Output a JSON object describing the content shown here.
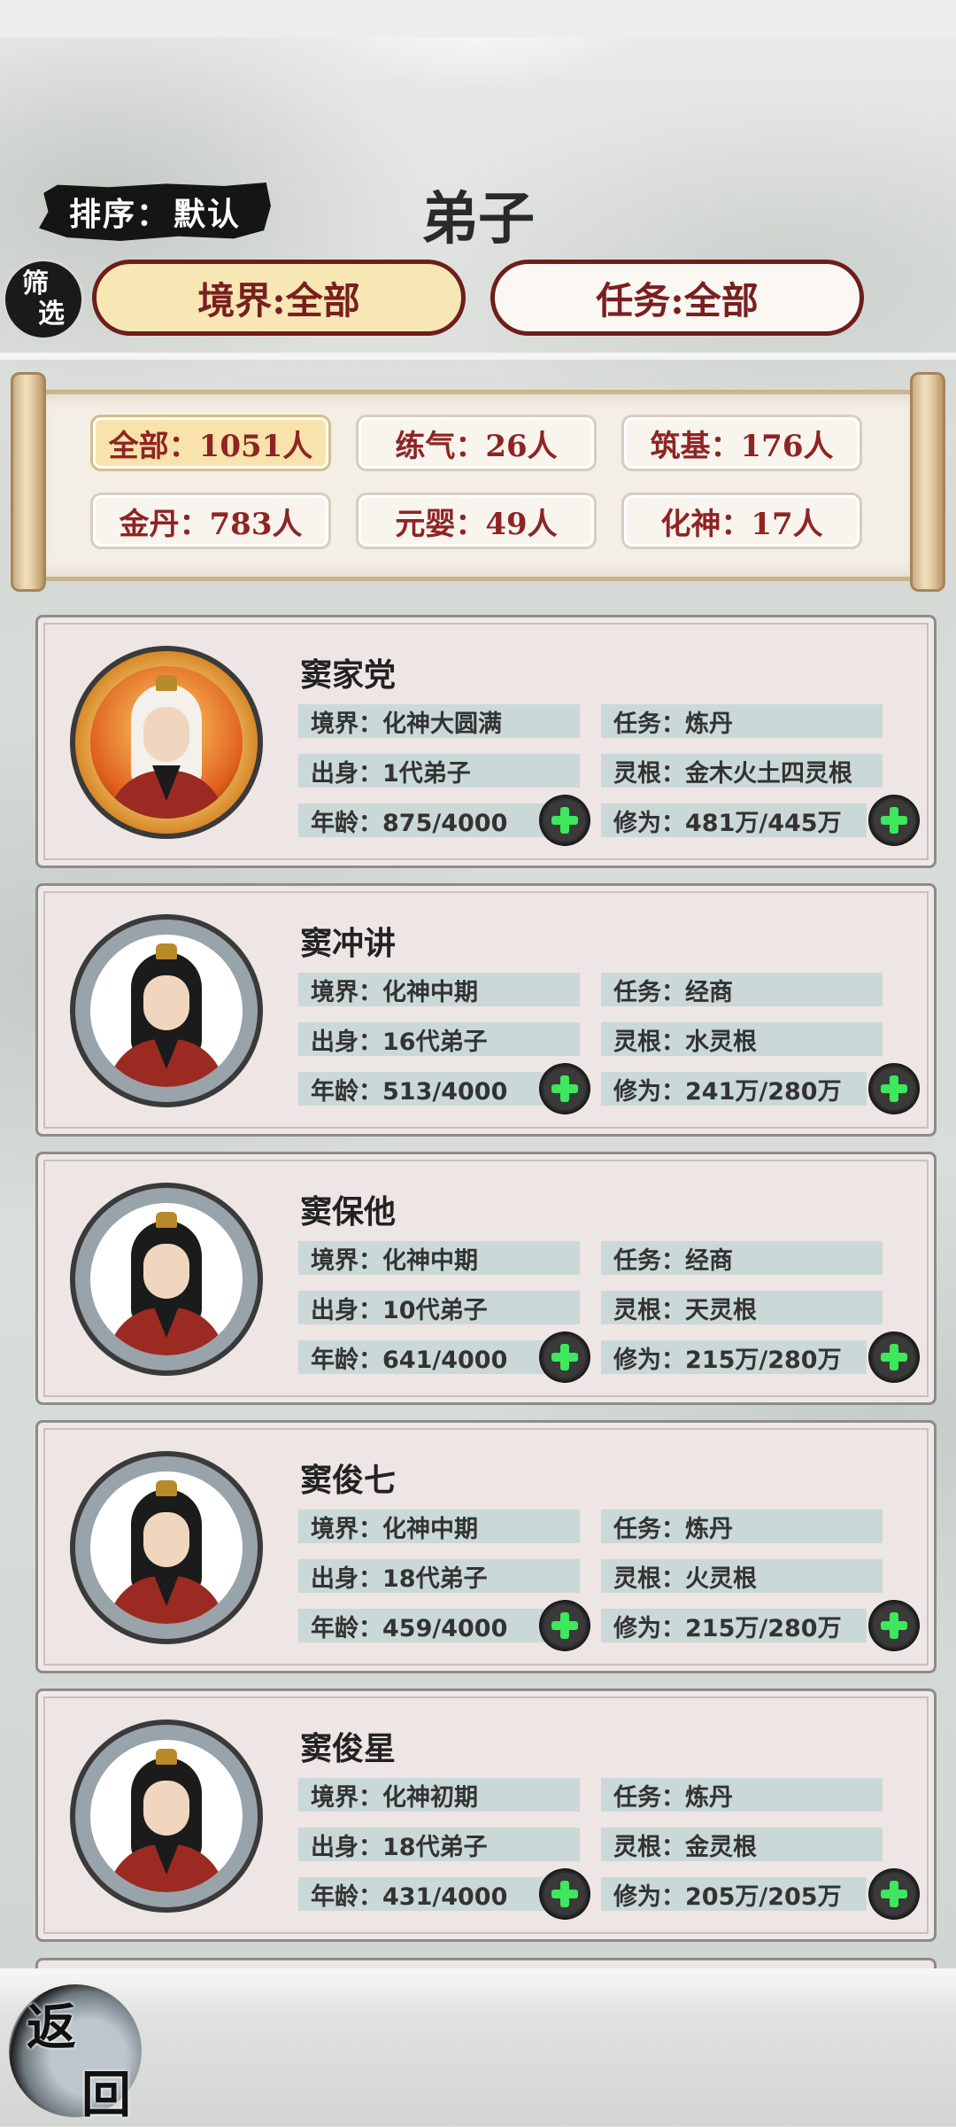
{
  "header": {
    "title": "弟子",
    "sort_label": "排序：",
    "sort_value": "默认",
    "filter_icon_top": "筛",
    "filter_icon_bottom": "选",
    "realm_filter": "境界:全部",
    "task_filter": "任务:全部"
  },
  "stats": [
    {
      "label": "全部：1051人",
      "active": true
    },
    {
      "label": "练气：26人",
      "active": false
    },
    {
      "label": "筑基：176人",
      "active": false
    },
    {
      "label": "金丹：783人",
      "active": false
    },
    {
      "label": "元婴：49人",
      "active": false
    },
    {
      "label": "化神：17人",
      "active": false
    }
  ],
  "disciples": [
    {
      "name": "窦家党",
      "realm": "境界：化神大圆满",
      "task": "任务：炼丹",
      "origin": "出身：1代弟子",
      "root": "灵根：金木火土四灵根",
      "age": "年龄：875/4000",
      "cultivation": "修为：481万/445万",
      "avatar": "gold"
    },
    {
      "name": "窦冲讲",
      "realm": "境界：化神中期",
      "task": "任务：经商",
      "origin": "出身：16代弟子",
      "root": "灵根：水灵根",
      "age": "年龄：513/4000",
      "cultivation": "修为：241万/280万",
      "avatar": "silver"
    },
    {
      "name": "窦保他",
      "realm": "境界：化神中期",
      "task": "任务：经商",
      "origin": "出身：10代弟子",
      "root": "灵根：天灵根",
      "age": "年龄：641/4000",
      "cultivation": "修为：215万/280万",
      "avatar": "silver"
    },
    {
      "name": "窦俊七",
      "realm": "境界：化神中期",
      "task": "任务：炼丹",
      "origin": "出身：18代弟子",
      "root": "灵根：火灵根",
      "age": "年龄：459/4000",
      "cultivation": "修为：215万/280万",
      "avatar": "silver"
    },
    {
      "name": "窦俊星",
      "realm": "境界：化神初期",
      "task": "任务：炼丹",
      "origin": "出身：18代弟子",
      "root": "灵根：金灵根",
      "age": "年龄：431/4000",
      "cultivation": "修为：205万/205万",
      "avatar": "silver"
    }
  ],
  "footer": {
    "back_top": "返",
    "back_bottom": "回"
  },
  "icons": {
    "add": "plus-icon",
    "accent_green": "#3ee85c",
    "accent_red": "#8e2424"
  }
}
